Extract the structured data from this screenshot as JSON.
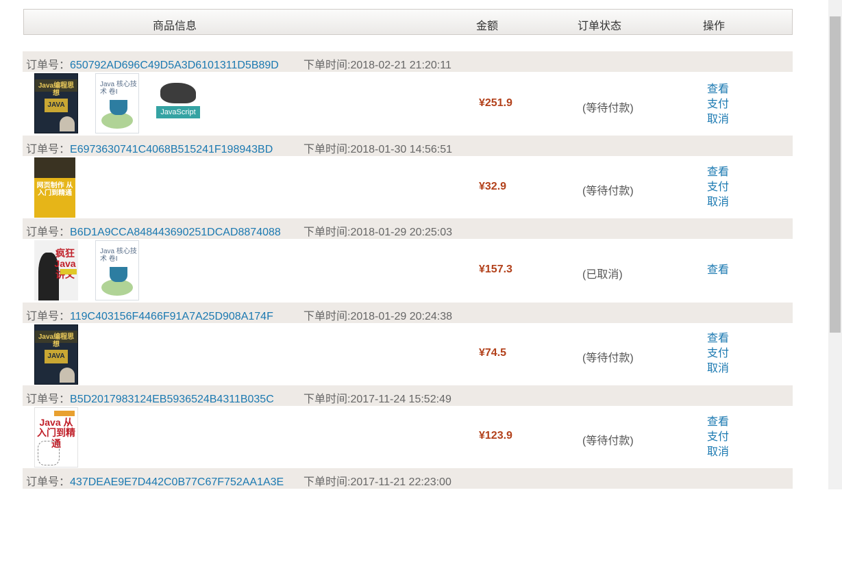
{
  "header": {
    "product_info": "商品信息",
    "amount": "金额",
    "status": "订单状态",
    "actions": "操作"
  },
  "labels": {
    "order_no": "订单号：",
    "order_time_prefix": "下单时间:"
  },
  "orders": [
    {
      "id": "650792AD696C49D5A3D6101311D5B89D",
      "time": "2018-02-21 21:20:11",
      "books": [
        {
          "title": "Java编程思想",
          "icon": "book-cover-java-thinking"
        },
        {
          "title": "Java 核心技术 卷Ⅰ",
          "icon": "book-cover-java-core"
        },
        {
          "title": "JavaScript",
          "icon": "book-cover-javascript"
        }
      ],
      "price": "¥251.9",
      "status": "(等待付款)",
      "actions": [
        "查看",
        "支付",
        "取消"
      ]
    },
    {
      "id": "E6973630741C4068B515241F198943BD",
      "time": "2018-01-30 14:56:51",
      "books": [
        {
          "title": "网页制作 从入门到精通",
          "icon": "book-cover-html-css"
        }
      ],
      "price": "¥32.9",
      "status": "(等待付款)",
      "actions": [
        "查看",
        "支付",
        "取消"
      ]
    },
    {
      "id": "B6D1A9CCA848443690251DCAD8874088",
      "time": "2018-01-29 20:25:03",
      "books": [
        {
          "title": "疯狂 Java讲义",
          "icon": "book-cover-crazy-java"
        },
        {
          "title": "Java 核心技术 卷Ⅰ",
          "icon": "book-cover-java-core"
        }
      ],
      "price": "¥157.3",
      "status": "(已取消)",
      "actions": [
        "查看"
      ]
    },
    {
      "id": "119C403156F4466F91A7A25D908A174F",
      "time": "2018-01-29 20:24:38",
      "books": [
        {
          "title": "Java编程思想",
          "icon": "book-cover-java-thinking"
        }
      ],
      "price": "¥74.5",
      "status": "(等待付款)",
      "actions": [
        "查看",
        "支付",
        "取消"
      ]
    },
    {
      "id": "B5D2017983124EB5936524B4311B035C",
      "time": "2017-11-24 15:52:49",
      "books": [
        {
          "title": "Java 从入门到精通",
          "icon": "book-cover-java-entry"
        }
      ],
      "price": "¥123.9",
      "status": "(等待付款)",
      "actions": [
        "查看",
        "支付",
        "取消"
      ]
    },
    {
      "id": "437DEAE9E7D442C0B77C67F752AA1A3E",
      "time": "2017-11-21 22:23:00",
      "books": [],
      "price": "",
      "status": "",
      "actions": []
    }
  ]
}
